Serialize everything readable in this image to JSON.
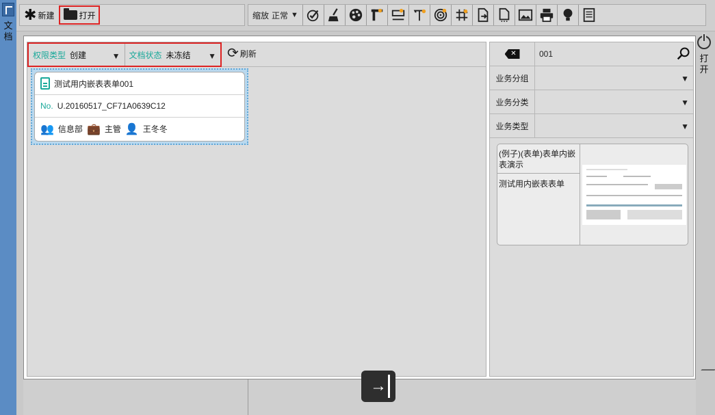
{
  "left_strip": {
    "label": "文档"
  },
  "toolbar": {
    "new_label": "新建",
    "open_label": "打开",
    "zoom_label": "缩放",
    "zoom_value": "正常",
    "tools": [
      "check-icon",
      "broom-icon",
      "palette-icon",
      "ruler-vertical-icon",
      "ruler-horizontal-icon",
      "text-icon",
      "spiral-icon",
      "grid-icon",
      "export-icon",
      "page-dots-icon",
      "image-icon",
      "printer-icon",
      "bulb-icon",
      "document-icon"
    ]
  },
  "right_strip": {
    "label": "打开"
  },
  "filters": {
    "permission": {
      "label": "权限类型",
      "value": "创建"
    },
    "status": {
      "label": "文档状态",
      "value": "未冻结"
    },
    "refresh_label": "刷新"
  },
  "doc_card": {
    "title": "测试用内嵌表表单001",
    "no_label": "No.",
    "no_value": "U.20160517_CF71A0639C12",
    "department": "信息部",
    "role": "主管",
    "user": "王冬冬"
  },
  "search": {
    "value": "001"
  },
  "selects": [
    {
      "label": "业务分组"
    },
    {
      "label": "业务分类"
    },
    {
      "label": "业务类型"
    }
  ],
  "result": {
    "title": "(例子)(表单)表单内嵌表演示",
    "subtitle": "测试用内嵌表表单"
  },
  "colors": {
    "accent": "#1aa99a",
    "highlight": "#dd2222",
    "side": "#5b8cc4"
  }
}
